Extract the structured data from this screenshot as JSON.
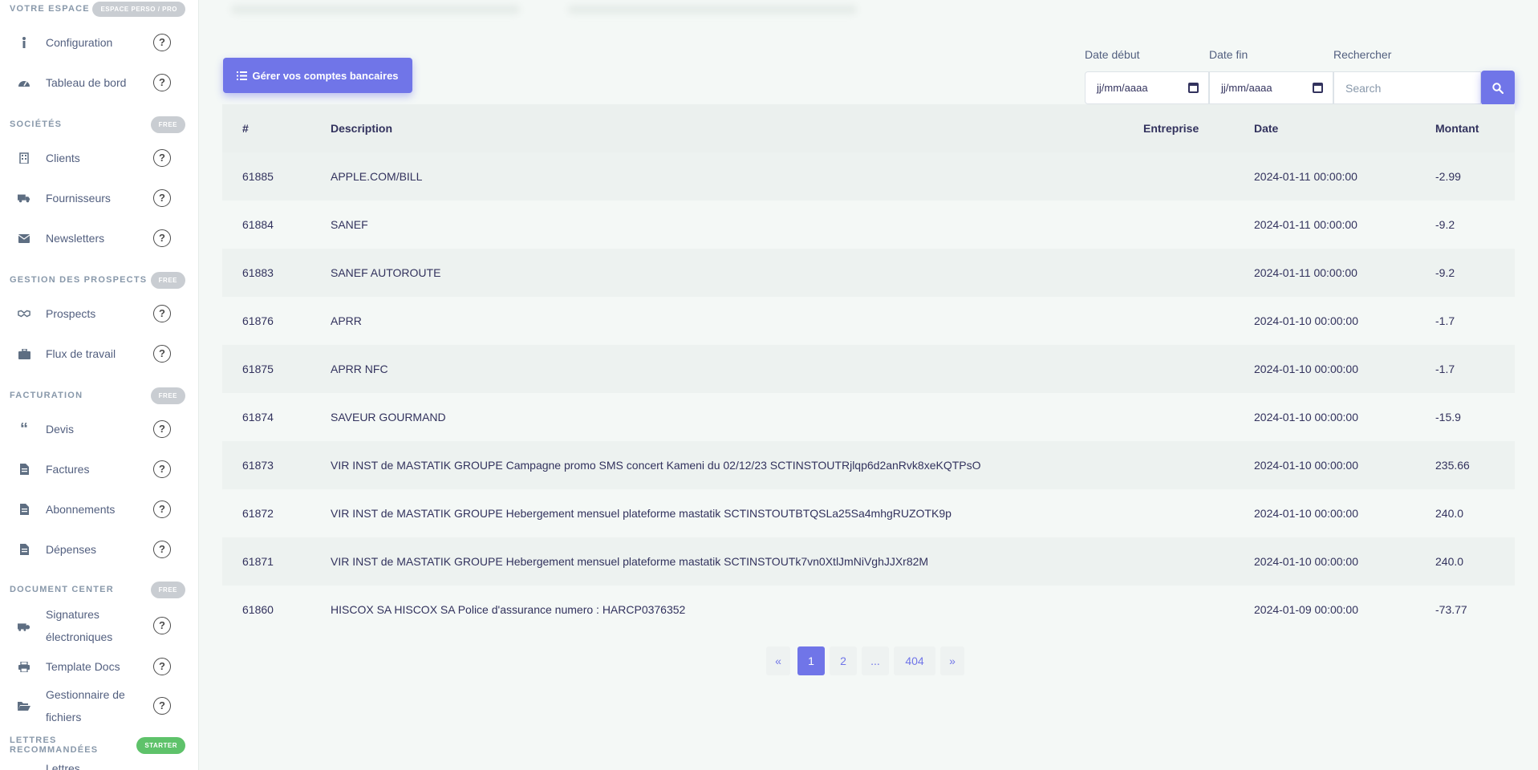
{
  "sidebar": {
    "sections": [
      {
        "title": "VOTRE ESPACE",
        "badge": "ESPACE PERSO / PRO",
        "items": [
          {
            "label": "Configuration",
            "icon": "info-icon"
          },
          {
            "label": "Tableau de bord",
            "icon": "dashboard-icon"
          }
        ]
      },
      {
        "title": "SOCIÉTÉS",
        "badge": "FREE",
        "items": [
          {
            "label": "Clients",
            "icon": "building-icon"
          },
          {
            "label": "Fournisseurs",
            "icon": "truck-icon"
          },
          {
            "label": "Newsletters",
            "icon": "envelope-icon"
          }
        ]
      },
      {
        "title": "GESTION DES PROSPECTS",
        "badge": "FREE",
        "items": [
          {
            "label": "Prospects",
            "icon": "handshake-icon"
          },
          {
            "label": "Flux de travail",
            "icon": "briefcase-icon"
          }
        ]
      },
      {
        "title": "FACTURATION",
        "badge": "FREE",
        "items": [
          {
            "label": "Devis",
            "icon": "quote-icon"
          },
          {
            "label": "Factures",
            "icon": "invoice-icon"
          },
          {
            "label": "Abonnements",
            "icon": "subscription-icon"
          },
          {
            "label": "Dépenses",
            "icon": "expense-icon"
          }
        ]
      },
      {
        "title": "DOCUMENT CENTER",
        "badge": "FREE",
        "items": [
          {
            "label": "Signatures électroniques",
            "icon": "signature-icon"
          },
          {
            "label": "Template Docs",
            "icon": "print-icon"
          },
          {
            "label": "Gestionnaire de fichiers",
            "icon": "folder-open-icon"
          }
        ]
      },
      {
        "title": "LETTRES RECOMMANDÉES",
        "badge": "STARTER",
        "items": [
          {
            "label": "Lettres",
            "icon": "letter-icon"
          }
        ]
      }
    ],
    "help_glyph": "?"
  },
  "toolbar": {
    "manage_button": "Gérer vos comptes bancaires",
    "date_start_label": "Date début",
    "date_end_label": "Date fin",
    "search_label": "Rechercher",
    "date_start_value": "jj/mm/aaaa",
    "date_end_value": "jj/mm/aaaa",
    "search_placeholder": "Search"
  },
  "table": {
    "headers": {
      "id": "#",
      "description": "Description",
      "entreprise": "Entreprise",
      "date": "Date",
      "montant": "Montant"
    },
    "rows": [
      {
        "id": "61885",
        "description": "APPLE.COM/BILL",
        "entreprise": "",
        "date": "2024-01-11 00:00:00",
        "montant": "-2.99"
      },
      {
        "id": "61884",
        "description": "SANEF",
        "entreprise": "",
        "date": "2024-01-11 00:00:00",
        "montant": "-9.2"
      },
      {
        "id": "61883",
        "description": "SANEF AUTOROUTE",
        "entreprise": "",
        "date": "2024-01-11 00:00:00",
        "montant": "-9.2"
      },
      {
        "id": "61876",
        "description": "APRR",
        "entreprise": "",
        "date": "2024-01-10 00:00:00",
        "montant": "-1.7"
      },
      {
        "id": "61875",
        "description": "APRR NFC",
        "entreprise": "",
        "date": "2024-01-10 00:00:00",
        "montant": "-1.7"
      },
      {
        "id": "61874",
        "description": "SAVEUR GOURMAND",
        "entreprise": "",
        "date": "2024-01-10 00:00:00",
        "montant": "-15.9"
      },
      {
        "id": "61873",
        "description": "VIR INST de MASTATIK GROUPE Campagne promo SMS concert Kameni du 02/12/23 SCTINSTOUTRjlqp6d2anRvk8xeKQTPsO",
        "entreprise": "",
        "date": "2024-01-10 00:00:00",
        "montant": "235.66"
      },
      {
        "id": "61872",
        "description": "VIR INST de MASTATIK GROUPE Hebergement mensuel plateforme mastatik SCTINSTOUTBTQSLa25Sa4mhgRUZOTK9p",
        "entreprise": "",
        "date": "2024-01-10 00:00:00",
        "montant": "240.0"
      },
      {
        "id": "61871",
        "description": "VIR INST de MASTATIK GROUPE Hebergement mensuel plateforme mastatik SCTINSTOUTk7vn0XtlJmNiVghJJXr82M",
        "entreprise": "",
        "date": "2024-01-10 00:00:00",
        "montant": "240.0"
      },
      {
        "id": "61860",
        "description": "HISCOX SA HISCOX SA Police d'assurance numero : HARCP0376352",
        "entreprise": "",
        "date": "2024-01-09 00:00:00",
        "montant": "-73.77"
      }
    ]
  },
  "pagination": {
    "prev": "«",
    "pages": [
      "1",
      "2",
      "...",
      "404"
    ],
    "current": "1",
    "next": "»"
  },
  "colors": {
    "accent": "#7075e8",
    "starter_badge": "#5ec26a",
    "free_badge": "#c9cdd2"
  }
}
